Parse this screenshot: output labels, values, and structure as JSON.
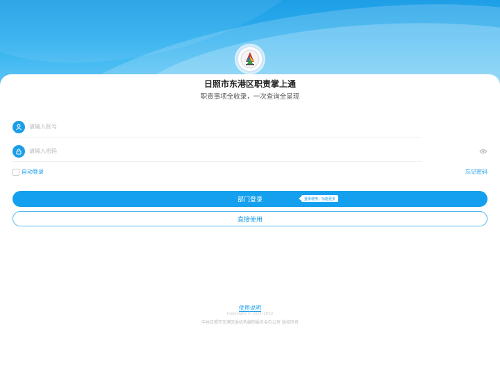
{
  "header": {
    "title": "日照市东港区职责掌上通",
    "subtitle": "职责事项全收录，一次查询全呈现"
  },
  "form": {
    "username_placeholder": "请输入账号",
    "password_placeholder": "请输入密码",
    "auto_login_label": "自动登录",
    "forgot_password_label": "忘记密码"
  },
  "buttons": {
    "login_label": "部门登录",
    "login_tip": "登录使用，功能更多",
    "direct_use_label": "直接使用"
  },
  "footer": {
    "help_link": "使用说明",
    "copyright": "Copyright © 2021-2022",
    "organization": "中共日照市东港区委机构编制委员会办公室 版权所有"
  },
  "colors": {
    "accent": "#14a0ee",
    "header_gradient_top": "#1e9ee6",
    "header_gradient_bottom": "#62c7f5"
  },
  "icons": {
    "user": "user-icon",
    "lock": "lock-icon",
    "eye": "eye-icon",
    "logo": "emblem-logo"
  }
}
